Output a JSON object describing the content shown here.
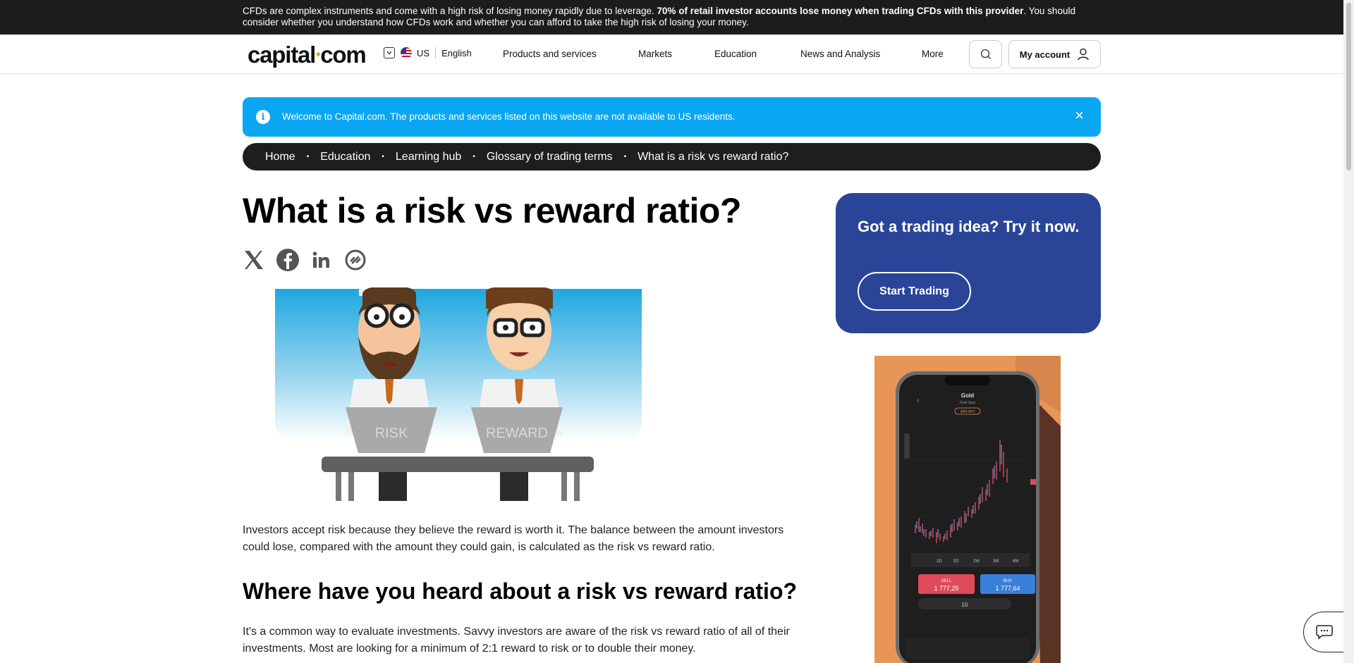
{
  "risk_warning": {
    "text_before": "CFDs are complex instruments and come with a high risk of losing money rapidly due to leverage. ",
    "bold": "70% of retail investor accounts lose money when trading CFDs with this provider",
    "text_after": ". You should consider whether you understand how CFDs work and whether you can afford to take the high risk of losing your money."
  },
  "header": {
    "logo_left": "capital",
    "logo_dot": "•",
    "logo_right": "com",
    "region": "US",
    "language": "English",
    "nav": [
      "Products and services",
      "Markets",
      "Education",
      "News and Analysis",
      "More"
    ],
    "account_label": "My account"
  },
  "notice": {
    "text": "Welcome to Capital.com. The products and services listed on this website are not available to US residents.",
    "close": "×"
  },
  "breadcrumb": [
    "Home",
    "Education",
    "Learning hub",
    "Glossary of trading terms",
    "What is a risk vs reward ratio?"
  ],
  "article": {
    "title": "What is a risk vs reward ratio?",
    "hero_labels": {
      "left": "RISK",
      "right": "REWARD"
    },
    "intro": "Investors accept risk because they believe the reward is worth it. The balance between the amount investors could lose, compared with the amount they could gain, is calculated as the risk vs reward ratio.",
    "section_heading": "Where have you heard about a risk vs reward ratio?",
    "section_text": "It's a common way to evaluate investments. Savvy investors are aware of the risk vs reward ratio of all of their investments. Most are looking for a minimum of 2:1 reward to risk or to double their money."
  },
  "promo": {
    "title": "Got a trading idea? Try it now.",
    "cta": "Start Trading"
  },
  "ad": {
    "asset": "Gold",
    "subtitle": "Gold Spot",
    "add_alert": "Add alert",
    "timeframes": [
      "1D",
      "5D",
      "2W",
      "3M",
      "6M"
    ],
    "sell_label": "SELL",
    "sell_price": "1 777,25",
    "buy_label": "BUY",
    "buy_price": "1 777,64",
    "quantity": "10"
  },
  "colors": {
    "accent_blue": "#0aa6f2",
    "promo_blue": "#2a4598",
    "dark": "#1e1e1e",
    "ad_orange": "#e8955a"
  }
}
